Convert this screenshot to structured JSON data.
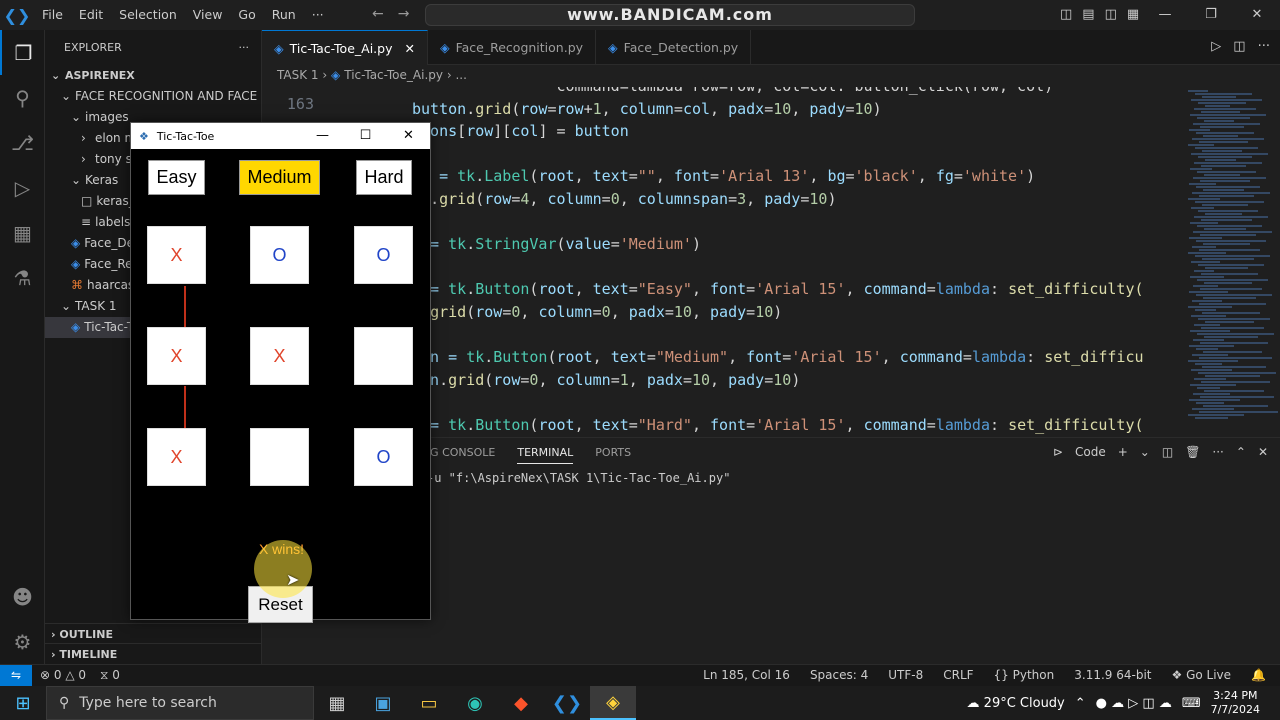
{
  "watermark": "www.BANDICAM.com",
  "menu": [
    "File",
    "Edit",
    "Selection",
    "View",
    "Go",
    "Run",
    "···"
  ],
  "explorer": {
    "header": "EXPLORER",
    "root": "ASPIRENEX",
    "items": [
      {
        "label": "FACE RECOGNITION AND FACE ...",
        "kind": "folder-open",
        "indent": 1
      },
      {
        "label": "images",
        "kind": "folder-open",
        "indent": 2
      },
      {
        "label": "elon m",
        "kind": "folder",
        "indent": 3
      },
      {
        "label": "tony st",
        "kind": "folder",
        "indent": 3
      },
      {
        "label": "Keras",
        "kind": "folder-open",
        "indent": 2
      },
      {
        "label": "keras_r",
        "kind": "file",
        "indent": 3
      },
      {
        "label": "labels.t",
        "kind": "txt",
        "indent": 3
      },
      {
        "label": "Face_De",
        "kind": "py",
        "indent": 2
      },
      {
        "label": "Face_Rec",
        "kind": "py",
        "indent": 2
      },
      {
        "label": "haarcasc",
        "kind": "xml",
        "indent": 2
      },
      {
        "label": "TASK 1",
        "kind": "folder-open",
        "indent": 1
      },
      {
        "label": "Tic-Tac-T",
        "kind": "py",
        "indent": 2,
        "selected": true
      }
    ],
    "outline": "OUTLINE",
    "timeline": "TIMELINE"
  },
  "tabs": [
    {
      "label": "Tic-Tac-Toe_Ai.py",
      "active": true
    },
    {
      "label": "Face_Recognition.py",
      "active": false
    },
    {
      "label": "Face_Detection.py",
      "active": false
    }
  ],
  "breadcrumb": [
    "TASK 1",
    "Tic-Tac-Toe_Ai.py",
    "..."
  ],
  "editor": {
    "line_number": "163",
    "lines": [
      [
        {
          "t": "                command=lambda row=row, col=col: button_click(row, col)",
          "c": "k-def"
        }
      ],
      [
        {
          "t": "button",
          "c": "k-var"
        },
        {
          "t": ".",
          "c": "k-def"
        },
        {
          "t": "grid",
          "c": "k-fn"
        },
        {
          "t": "(",
          "c": "k-def"
        },
        {
          "t": "row",
          "c": "k-var"
        },
        {
          "t": "=",
          "c": "k-def"
        },
        {
          "t": "row",
          "c": "k-var"
        },
        {
          "t": "+",
          "c": "k-def"
        },
        {
          "t": "1",
          "c": "k-num"
        },
        {
          "t": ", ",
          "c": "k-def"
        },
        {
          "t": "column",
          "c": "k-var"
        },
        {
          "t": "=",
          "c": "k-def"
        },
        {
          "t": "col",
          "c": "k-var"
        },
        {
          "t": ", ",
          "c": "k-def"
        },
        {
          "t": "padx",
          "c": "k-var"
        },
        {
          "t": "=",
          "c": "k-def"
        },
        {
          "t": "10",
          "c": "k-num"
        },
        {
          "t": ", ",
          "c": "k-def"
        },
        {
          "t": "pady",
          "c": "k-var"
        },
        {
          "t": "=",
          "c": "k-def"
        },
        {
          "t": "10",
          "c": "k-num"
        },
        {
          "t": ")",
          "c": "k-def"
        }
      ],
      [
        {
          "t": "ttons",
          "c": "k-var"
        },
        {
          "t": "[",
          "c": "k-def"
        },
        {
          "t": "row",
          "c": "k-var"
        },
        {
          "t": "][",
          "c": "k-def"
        },
        {
          "t": "col",
          "c": "k-var"
        },
        {
          "t": "] = ",
          "c": "k-def"
        },
        {
          "t": "button",
          "c": "k-var"
        }
      ],
      [],
      [
        {
          "t": "el = ",
          "c": "k-var"
        },
        {
          "t": "tk",
          "c": "k-cls"
        },
        {
          "t": ".",
          "c": "k-def"
        },
        {
          "t": "Label",
          "c": "k-cls"
        },
        {
          "t": "(",
          "c": "k-def"
        },
        {
          "t": "root",
          "c": "k-var"
        },
        {
          "t": ", ",
          "c": "k-def"
        },
        {
          "t": "text",
          "c": "k-var"
        },
        {
          "t": "=",
          "c": "k-def"
        },
        {
          "t": "\"\"",
          "c": "k-str"
        },
        {
          "t": ", ",
          "c": "k-def"
        },
        {
          "t": "font",
          "c": "k-var"
        },
        {
          "t": "=",
          "c": "k-def"
        },
        {
          "t": "'Arial 13'",
          "c": "k-str"
        },
        {
          "t": ", ",
          "c": "k-def"
        },
        {
          "t": "bg",
          "c": "k-var"
        },
        {
          "t": "=",
          "c": "k-def"
        },
        {
          "t": "'black'",
          "c": "k-str"
        },
        {
          "t": ", ",
          "c": "k-def"
        },
        {
          "t": "fg",
          "c": "k-var"
        },
        {
          "t": "=",
          "c": "k-def"
        },
        {
          "t": "'white'",
          "c": "k-str"
        },
        {
          "t": ")",
          "c": "k-def"
        }
      ],
      [
        {
          "t": "el",
          "c": "k-var"
        },
        {
          "t": ".",
          "c": "k-def"
        },
        {
          "t": "grid",
          "c": "k-fn"
        },
        {
          "t": "(",
          "c": "k-def"
        },
        {
          "t": "row",
          "c": "k-var"
        },
        {
          "t": "=",
          "c": "k-def"
        },
        {
          "t": "4",
          "c": "k-num"
        },
        {
          "t": ", ",
          "c": "k-def"
        },
        {
          "t": "column",
          "c": "k-var"
        },
        {
          "t": "=",
          "c": "k-def"
        },
        {
          "t": "0",
          "c": "k-num"
        },
        {
          "t": ", ",
          "c": "k-def"
        },
        {
          "t": "columnspan",
          "c": "k-var"
        },
        {
          "t": "=",
          "c": "k-def"
        },
        {
          "t": "3",
          "c": "k-num"
        },
        {
          "t": ", ",
          "c": "k-def"
        },
        {
          "t": "pady",
          "c": "k-var"
        },
        {
          "t": "=",
          "c": "k-def"
        },
        {
          "t": "10",
          "c": "k-num"
        },
        {
          "t": ")",
          "c": "k-def"
        }
      ],
      [],
      [
        {
          "t": "  = ",
          "c": "k-var"
        },
        {
          "t": "tk",
          "c": "k-cls"
        },
        {
          "t": ".",
          "c": "k-def"
        },
        {
          "t": "StringVar",
          "c": "k-cls"
        },
        {
          "t": "(",
          "c": "k-def"
        },
        {
          "t": "value",
          "c": "k-var"
        },
        {
          "t": "=",
          "c": "k-def"
        },
        {
          "t": "'Medium'",
          "c": "k-str"
        },
        {
          "t": ")",
          "c": "k-def"
        }
      ],
      [],
      [
        {
          "t": "n = ",
          "c": "k-var"
        },
        {
          "t": "tk",
          "c": "k-cls"
        },
        {
          "t": ".",
          "c": "k-def"
        },
        {
          "t": "Button",
          "c": "k-cls"
        },
        {
          "t": "(",
          "c": "k-def"
        },
        {
          "t": "root",
          "c": "k-var"
        },
        {
          "t": ", ",
          "c": "k-def"
        },
        {
          "t": "text",
          "c": "k-var"
        },
        {
          "t": "=",
          "c": "k-def"
        },
        {
          "t": "\"Easy\"",
          "c": "k-str"
        },
        {
          "t": ", ",
          "c": "k-def"
        },
        {
          "t": "font",
          "c": "k-var"
        },
        {
          "t": "=",
          "c": "k-def"
        },
        {
          "t": "'Arial 15'",
          "c": "k-str"
        },
        {
          "t": ", ",
          "c": "k-def"
        },
        {
          "t": "command",
          "c": "k-var"
        },
        {
          "t": "=",
          "c": "k-def"
        },
        {
          "t": "lambda",
          "c": "k-lam"
        },
        {
          "t": ": ",
          "c": "k-def"
        },
        {
          "t": "set_difficulty(",
          "c": "k-fn"
        }
      ],
      [
        {
          "t": "n",
          "c": "k-var"
        },
        {
          "t": ".",
          "c": "k-def"
        },
        {
          "t": "grid",
          "c": "k-fn"
        },
        {
          "t": "(",
          "c": "k-def"
        },
        {
          "t": "row",
          "c": "k-var"
        },
        {
          "t": "=",
          "c": "k-def"
        },
        {
          "t": "0",
          "c": "k-num"
        },
        {
          "t": ", ",
          "c": "k-def"
        },
        {
          "t": "column",
          "c": "k-var"
        },
        {
          "t": "=",
          "c": "k-def"
        },
        {
          "t": "0",
          "c": "k-num"
        },
        {
          "t": ", ",
          "c": "k-def"
        },
        {
          "t": "padx",
          "c": "k-var"
        },
        {
          "t": "=",
          "c": "k-def"
        },
        {
          "t": "10",
          "c": "k-num"
        },
        {
          "t": ", ",
          "c": "k-def"
        },
        {
          "t": "pady",
          "c": "k-var"
        },
        {
          "t": "=",
          "c": "k-def"
        },
        {
          "t": "10",
          "c": "k-num"
        },
        {
          "t": ")",
          "c": "k-def"
        }
      ],
      [],
      [
        {
          "t": "ton = ",
          "c": "k-var"
        },
        {
          "t": "tk",
          "c": "k-cls"
        },
        {
          "t": ".",
          "c": "k-def"
        },
        {
          "t": "Button",
          "c": "k-cls"
        },
        {
          "t": "(",
          "c": "k-def"
        },
        {
          "t": "root",
          "c": "k-var"
        },
        {
          "t": ", ",
          "c": "k-def"
        },
        {
          "t": "text",
          "c": "k-var"
        },
        {
          "t": "=",
          "c": "k-def"
        },
        {
          "t": "\"Medium\"",
          "c": "k-str"
        },
        {
          "t": ", ",
          "c": "k-def"
        },
        {
          "t": "font",
          "c": "k-var"
        },
        {
          "t": "=",
          "c": "k-def"
        },
        {
          "t": "'Arial 15'",
          "c": "k-str"
        },
        {
          "t": ", ",
          "c": "k-def"
        },
        {
          "t": "command",
          "c": "k-var"
        },
        {
          "t": "=",
          "c": "k-def"
        },
        {
          "t": "lambda",
          "c": "k-lam"
        },
        {
          "t": ": ",
          "c": "k-def"
        },
        {
          "t": "set_difficu",
          "c": "k-fn"
        }
      ],
      [
        {
          "t": "ton",
          "c": "k-var"
        },
        {
          "t": ".",
          "c": "k-def"
        },
        {
          "t": "grid",
          "c": "k-fn"
        },
        {
          "t": "(",
          "c": "k-def"
        },
        {
          "t": "row",
          "c": "k-var"
        },
        {
          "t": "=",
          "c": "k-def"
        },
        {
          "t": "0",
          "c": "k-num"
        },
        {
          "t": ", ",
          "c": "k-def"
        },
        {
          "t": "column",
          "c": "k-var"
        },
        {
          "t": "=",
          "c": "k-def"
        },
        {
          "t": "1",
          "c": "k-num"
        },
        {
          "t": ", ",
          "c": "k-def"
        },
        {
          "t": "padx",
          "c": "k-var"
        },
        {
          "t": "=",
          "c": "k-def"
        },
        {
          "t": "10",
          "c": "k-num"
        },
        {
          "t": ", ",
          "c": "k-def"
        },
        {
          "t": "pady",
          "c": "k-var"
        },
        {
          "t": "=",
          "c": "k-def"
        },
        {
          "t": "10",
          "c": "k-num"
        },
        {
          "t": ")",
          "c": "k-def"
        }
      ],
      [],
      [
        {
          "t": "n = ",
          "c": "k-var"
        },
        {
          "t": "tk",
          "c": "k-cls"
        },
        {
          "t": ".",
          "c": "k-def"
        },
        {
          "t": "Button",
          "c": "k-cls"
        },
        {
          "t": "(",
          "c": "k-def"
        },
        {
          "t": "root",
          "c": "k-var"
        },
        {
          "t": ", ",
          "c": "k-def"
        },
        {
          "t": "text",
          "c": "k-var"
        },
        {
          "t": "=",
          "c": "k-def"
        },
        {
          "t": "\"Hard\"",
          "c": "k-str"
        },
        {
          "t": ", ",
          "c": "k-def"
        },
        {
          "t": "font",
          "c": "k-var"
        },
        {
          "t": "=",
          "c": "k-def"
        },
        {
          "t": "'Arial 15'",
          "c": "k-str"
        },
        {
          "t": ", ",
          "c": "k-def"
        },
        {
          "t": "command",
          "c": "k-var"
        },
        {
          "t": "=",
          "c": "k-def"
        },
        {
          "t": "lambda",
          "c": "k-lam"
        },
        {
          "t": ": ",
          "c": "k-def"
        },
        {
          "t": "set_difficulty(",
          "c": "k-fn"
        }
      ]
    ]
  },
  "panel": {
    "tabs": [
      "UG CONSOLE",
      "TERMINAL",
      "PORTS"
    ],
    "active_tab": "TERMINAL",
    "terminal_type": "Code",
    "terminal_line": "-u \"f:\\AspireNex\\TASK 1\\Tic-Tac-Toe_Ai.py\""
  },
  "statusbar": {
    "errors": "0",
    "warnings": "0",
    "ports": "0",
    "position": "Ln 185, Col 16",
    "spaces": "Spaces: 4",
    "encoding": "UTF-8",
    "eol": "CRLF",
    "language": "Python",
    "interpreter": "3.11.9 64-bit",
    "golive": "Go Live"
  },
  "taskbar": {
    "search_placeholder": "Type here to search",
    "weather": "29°C  Cloudy",
    "time": "3:24 PM",
    "date": "7/7/2024"
  },
  "tk_window": {
    "title": "Tic-Tac-Toe",
    "difficulty": [
      "Easy",
      "Medium",
      "Hard"
    ],
    "selected_difficulty": "Medium",
    "board": [
      [
        "X",
        "O",
        "O"
      ],
      [
        "X",
        "X",
        ""
      ],
      [
        "X",
        "",
        "O"
      ]
    ],
    "status": "X wins!",
    "reset_label": "Reset"
  },
  "colors": {
    "x_mark": "#e0452c",
    "o_mark": "#2145c8",
    "status_text": "#ff9a2e",
    "selected_difficulty": "#ffd700",
    "accent": "#0078d4"
  }
}
